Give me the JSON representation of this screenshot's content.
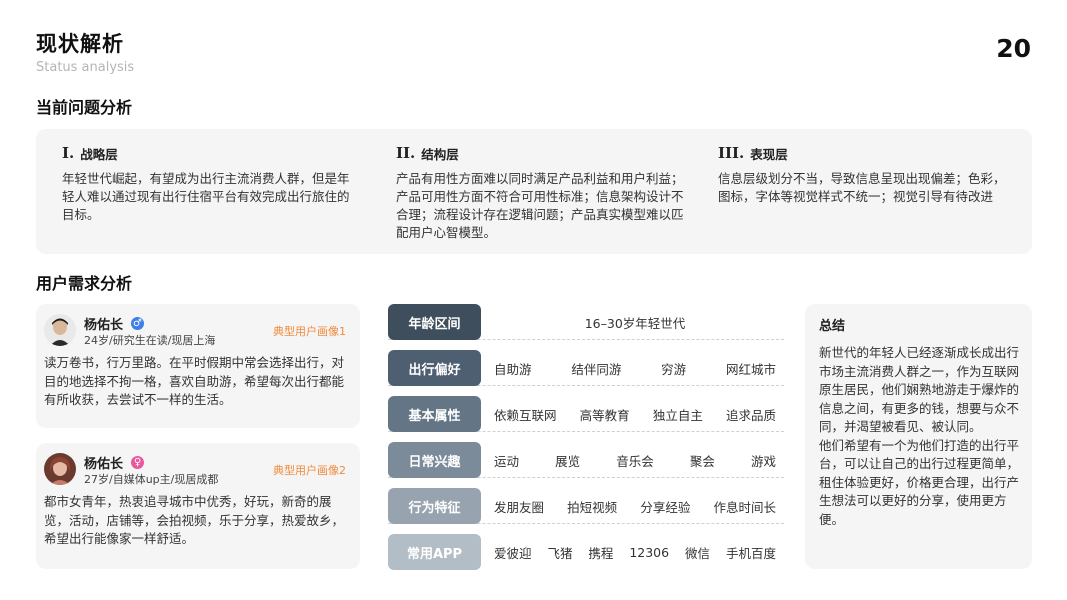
{
  "header": {
    "title": "现状解析",
    "subtitle": "Status analysis",
    "page_number": "20"
  },
  "problems": {
    "heading": "当前问题分析",
    "items": [
      {
        "roman": "I.",
        "title": "战略层",
        "text": "年轻世代崛起，有望成为出行主流消费人群，但是年轻人难以通过现有出行住宿平台有效完成出行旅住的目标。"
      },
      {
        "roman": "II.",
        "title": "结构层",
        "text": "产品有用性方面难以同时满足产品利益和用户利益；产品可用性方面不符合可用性标准；信息架构设计不合理；流程设计存在逻辑问题；产品真实模型难以匹配用户心智模型。"
      },
      {
        "roman": "III.",
        "title": "表现层",
        "text": "信息层级划分不当，导致信息呈现出现偏差；色彩，图标，字体等视觉样式不统一；视觉引导有待改进"
      }
    ]
  },
  "needs": {
    "heading": "用户需求分析",
    "personas": [
      {
        "name": "杨佑长",
        "gender": "male",
        "gender_symbol": "♂",
        "meta": "24岁/研究生在读/现居上海",
        "tag": "典型用户画像1",
        "desc": "读万卷书，行万里路。在平时假期中常会选择出行，对目的地选择不拘一格，喜欢自助游，希望每次出行都能有所收获，去尝试不一样的生活。"
      },
      {
        "name": "杨佑长",
        "gender": "female",
        "gender_symbol": "♀",
        "meta": "27岁/自媒体up主/现居成都",
        "tag": "典型用户画像2",
        "desc": "都市女青年，热衷追寻城市中优秀，好玩，新奇的展览，活动，店铺等，会拍视频，乐于分享，热爱故乡，希望出行能像家一样舒适。"
      }
    ],
    "attributes": [
      {
        "label": "年龄区间",
        "color": "#3e4e5d",
        "values": [
          "16–30岁年轻世代"
        ]
      },
      {
        "label": "出行偏好",
        "color": "#4d5f70",
        "values": [
          "自助游",
          "结伴同游",
          "穷游",
          "网红城市"
        ]
      },
      {
        "label": "基本属性",
        "color": "#647686",
        "values": [
          "依赖互联网",
          "高等教育",
          "独立自主",
          "追求品质"
        ]
      },
      {
        "label": "日常兴趣",
        "color": "#7b8b99",
        "values": [
          "运动",
          "展览",
          "音乐会",
          "聚会",
          "游戏"
        ]
      },
      {
        "label": "行为特征",
        "color": "#97a4b0",
        "values": [
          "发朋友圈",
          "拍短视频",
          "分享经验",
          "作息时间长"
        ]
      },
      {
        "label": "常用APP",
        "color": "#b3bdc6",
        "values": [
          "爱彼迎",
          "飞猪",
          "携程",
          "12306",
          "微信",
          "手机百度"
        ]
      }
    ],
    "summary": {
      "title": "总结",
      "text": "新世代的年轻人已经逐渐成长成出行市场主流消费人群之一，作为互联网原生居民，他们娴熟地游走于爆炸的信息之间，有更多的钱，想要与众不同，并渴望被看见、被认同。\n他们希望有一个为他们打造的出行平台，可以让自己的出行过程更简单，租住体验更好，价格更合理，出行产生想法可以更好的分享，使用更方便。"
    }
  }
}
